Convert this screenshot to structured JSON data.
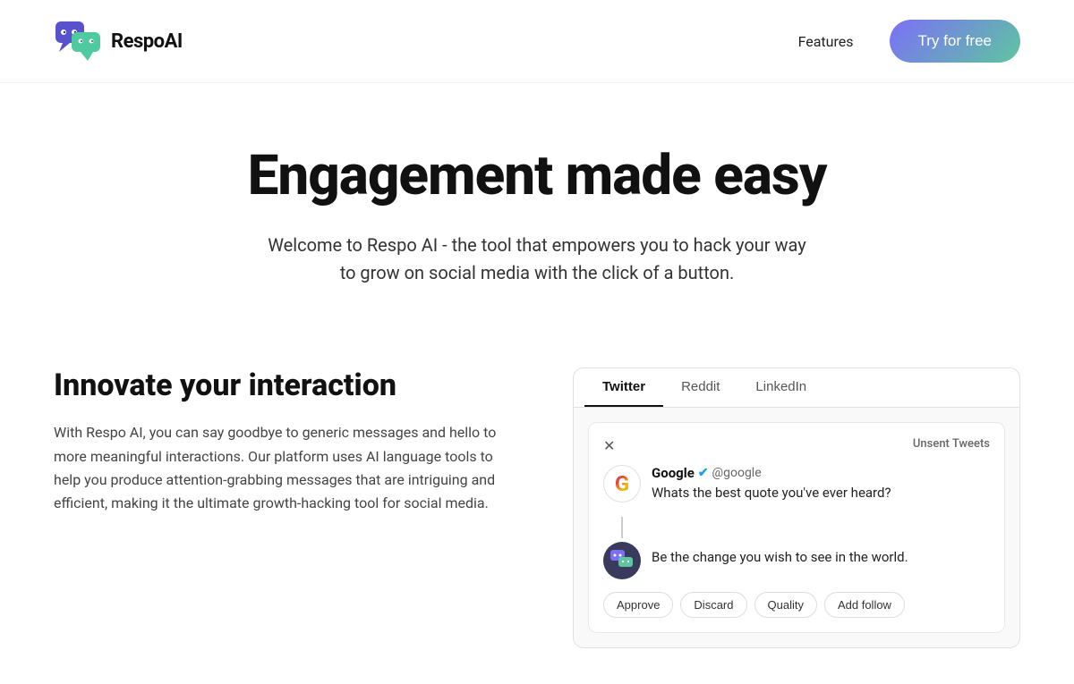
{
  "nav": {
    "logo_text": "RespoAI",
    "links": [
      {
        "label": "Features",
        "id": "features-link"
      }
    ],
    "cta_label": "Try for free"
  },
  "hero": {
    "heading": "Engagement made easy",
    "subtext": "Welcome to Respo AI - the tool that empowers you to hack your way to grow on social media with the click of a button."
  },
  "features": {
    "heading": "Innovate your interaction",
    "body": "With Respo AI, you can say goodbye to generic messages and hello to more meaningful interactions. Our platform uses AI language tools to help you produce attention-grabbing messages that are intriguing and efficient, making it the ultimate growth-hacking tool for social media."
  },
  "panel": {
    "tabs": [
      {
        "label": "Twitter",
        "active": true
      },
      {
        "label": "Reddit",
        "active": false
      },
      {
        "label": "LinkedIn",
        "active": false
      }
    ],
    "unsent_label": "Unsent Tweets",
    "tweet": {
      "author": "Google",
      "handle": "@google",
      "text": "Whats the best quote you've ever heard?",
      "reply_text": "Be the change you wish to see in the world."
    },
    "action_buttons": [
      "Approve",
      "Discard",
      "Quality",
      "Add follow"
    ]
  }
}
